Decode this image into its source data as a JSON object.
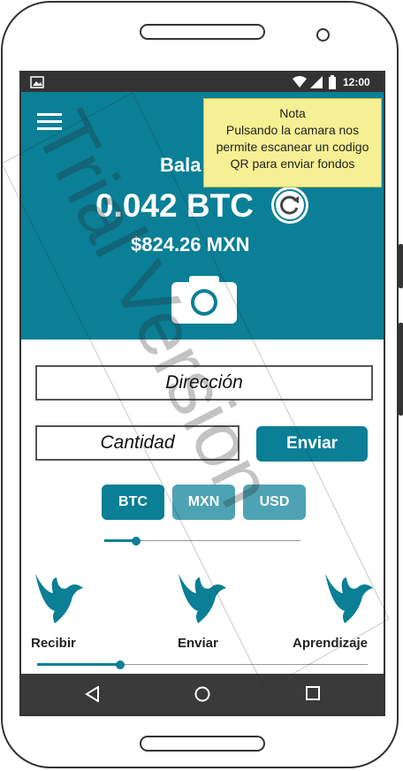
{
  "status_bar": {
    "time": "12:00"
  },
  "header": {
    "balance_label": "Bala",
    "btc_amount": "0.042 BTC",
    "fiat_amount": "$824.26 MXN"
  },
  "tooltip": {
    "title": "Nota",
    "line1": "Pulsando la camara nos",
    "line2": "permite escanear un codigo",
    "line3": "QR para enviar fondos"
  },
  "form": {
    "address_placeholder": "Dirección",
    "amount_placeholder": "Cantidad",
    "send_button": "Enviar"
  },
  "currency_tabs": [
    "BTC",
    "MXN",
    "USD"
  ],
  "currency_slider": {
    "value": 0.16
  },
  "bottom_menu": {
    "items": [
      {
        "label": "Recibir"
      },
      {
        "label": "Enviar"
      },
      {
        "label": "Aprendizaje"
      }
    ]
  },
  "bottom_slider": {
    "value": 0.25
  },
  "watermark": "Trial Version",
  "colors": {
    "primary": "#0a7f96",
    "tab_active": "#0a7f96",
    "tab_inactive": "#4da3b3",
    "tooltip_bg": "#f5f093",
    "navbar": "#3a3a3a"
  }
}
